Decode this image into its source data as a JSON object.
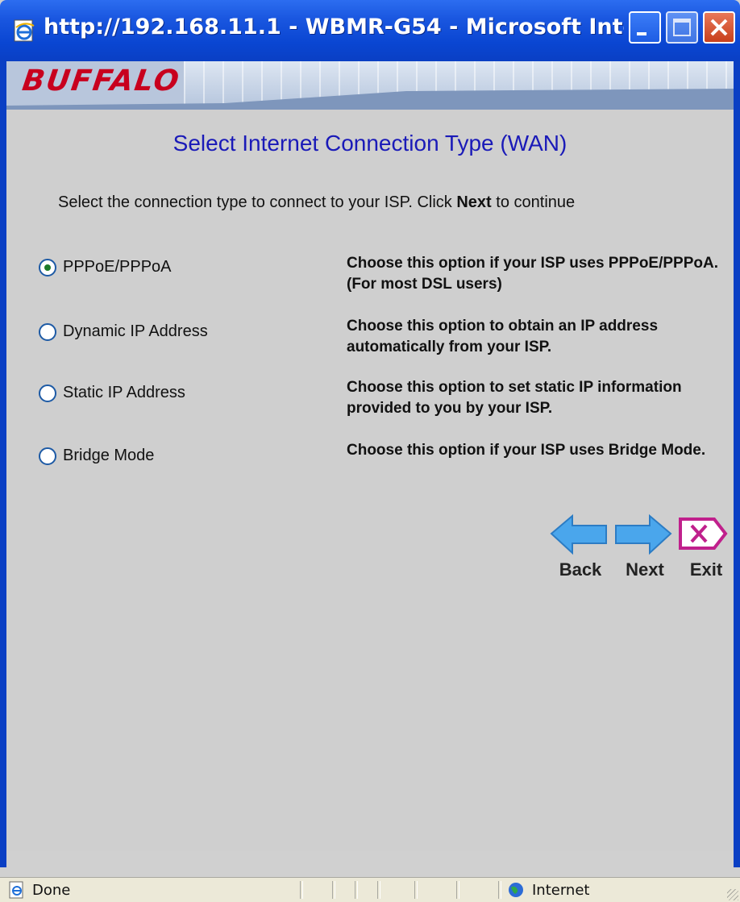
{
  "window": {
    "title": "http://192.168.11.1 - WBMR-G54 - Microsoft Internet E...",
    "icon": "ie-page-icon",
    "controls": [
      "minimize-button",
      "maximize-button",
      "close-button"
    ]
  },
  "banner": {
    "logo_text": "BUFFALO",
    "logo_color": "#c8001e"
  },
  "page": {
    "title": "Select Internet Connection Type (WAN)",
    "title_color": "#1a1ab8",
    "instruction_before": "Select the connection type to connect to your ISP. Click ",
    "instruction_bold": "Next",
    "instruction_after": " to continue"
  },
  "options": [
    {
      "label": "PPPoE/PPPoA",
      "checked": true,
      "description": "Choose this option if your ISP uses PPPoE/PPPoA. (For most DSL users)"
    },
    {
      "label": "Dynamic IP Address",
      "checked": false,
      "description": "Choose this option to obtain an IP address automatically from your ISP."
    },
    {
      "label": "Static IP Address",
      "checked": false,
      "description": "Choose this option to set static IP information provided to you by your ISP."
    },
    {
      "label": "Bridge Mode",
      "checked": false,
      "description": "Choose this option if your ISP uses Bridge Mode."
    }
  ],
  "nav": {
    "back_label": "Back",
    "next_label": "Next",
    "exit_label": "Exit"
  },
  "statusbar": {
    "status_text": "Done",
    "zone_text": "Internet"
  }
}
